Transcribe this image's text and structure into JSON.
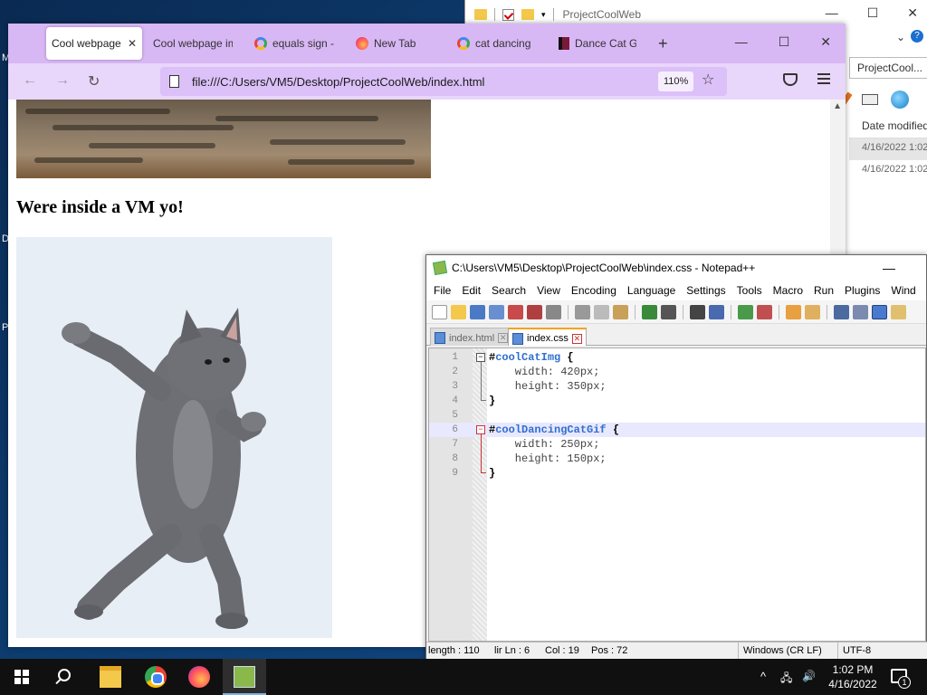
{
  "explorer": {
    "title": "ProjectCoolWeb",
    "address_crumb": "ProjectCool...",
    "column_header": "Date modified",
    "rows": [
      "4/16/2022 1:02",
      "4/16/2022 1:02"
    ]
  },
  "desktop_letters": [
    "M",
    "D",
    "P"
  ],
  "browser": {
    "tabs": [
      {
        "label": "Cool webpage",
        "icon": "none",
        "active": true
      },
      {
        "label": "Cool webpage im",
        "icon": "none",
        "active": false
      },
      {
        "label": "equals sign -",
        "icon": "google-icon",
        "active": false
      },
      {
        "label": "New Tab",
        "icon": "firefox-icon",
        "active": false
      },
      {
        "label": "cat dancing",
        "icon": "google-icon",
        "active": false
      },
      {
        "label": "Dance Cat Gi",
        "icon": "cat-icon",
        "active": false
      }
    ],
    "new_tab_glyph": "+",
    "close_glyph": "✕",
    "url": "file:///C:/Users/VM5/Desktop/ProjectCoolWeb/index.html",
    "zoom": "110%",
    "nav": {
      "back": "←",
      "forward": "→",
      "reload": "↻",
      "star": "☆"
    },
    "window_controls": {
      "minimize": "—",
      "maximize": "☐",
      "close": "✕"
    }
  },
  "page": {
    "heading": "Were inside a VM yo!"
  },
  "npp": {
    "title": "C:\\Users\\VM5\\Desktop\\ProjectCoolWeb\\index.css - Notepad++",
    "menu": [
      "File",
      "Edit",
      "Search",
      "View",
      "Encoding",
      "Language",
      "Settings",
      "Tools",
      "Macro",
      "Run",
      "Plugins",
      "Wind"
    ],
    "tabs": [
      {
        "label": "index.html",
        "active": false
      },
      {
        "label": "index.css",
        "active": true
      }
    ],
    "lines": [
      {
        "num": "1",
        "hash": "#",
        "id": "coolCatImg",
        "rest": " {"
      },
      {
        "num": "2",
        "text": "    width: 420px;"
      },
      {
        "num": "3",
        "text": "    height: 350px;"
      },
      {
        "num": "4",
        "text": "}"
      },
      {
        "num": "5",
        "text": ""
      },
      {
        "num": "6",
        "hash": "#",
        "id": "coolDancingCatGif",
        "rest": " {"
      },
      {
        "num": "7",
        "text": "    width: 250px;"
      },
      {
        "num": "8",
        "text": "    height: 150px;"
      },
      {
        "num": "9",
        "text": "}"
      }
    ],
    "current_line": 6,
    "status": {
      "length": "length : 110",
      "lines": "lir Ln : 6",
      "col": "Col : 19",
      "pos": "Pos : 72",
      "eol": "Windows (CR LF)",
      "encoding": "UTF-8"
    }
  },
  "taskbar": {
    "clock_time": "1:02 PM",
    "clock_date": "4/16/2022",
    "tray_chevron": "^",
    "notification_count": "1"
  },
  "colors": {
    "firefox_tabbar": "#d8b7f5",
    "firefox_navbar": "#e9d6fb",
    "npp_id_color": "#2f6fcf",
    "taskbar_bg": "#101010"
  }
}
